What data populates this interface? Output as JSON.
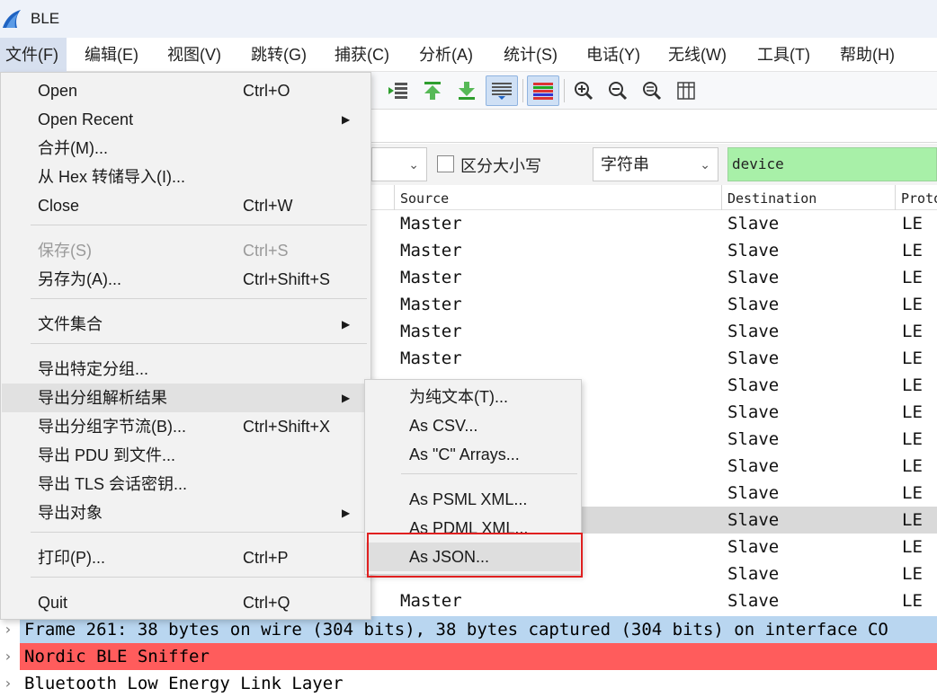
{
  "window": {
    "title": "BLE"
  },
  "menubar": [
    "文件(F)",
    "编辑(E)",
    "视图(V)",
    "跳转(G)",
    "捕获(C)",
    "分析(A)",
    "统计(S)",
    "电话(Y)",
    "无线(W)",
    "工具(T)",
    "帮助(H)"
  ],
  "find": {
    "case_label": "区分大小写",
    "type_value": "字符串",
    "search_value": "device"
  },
  "columns": {
    "source": "Source",
    "destination": "Destination",
    "protocol": "Proto"
  },
  "packets": [
    {
      "source": "Master",
      "destination": "Slave",
      "protocol": "LE"
    },
    {
      "source": "Master",
      "destination": "Slave",
      "protocol": "LE"
    },
    {
      "source": "Master",
      "destination": "Slave",
      "protocol": "LE"
    },
    {
      "source": "Master",
      "destination": "Slave",
      "protocol": "LE"
    },
    {
      "source": "Master",
      "destination": "Slave",
      "protocol": "LE"
    },
    {
      "source": "Master",
      "destination": "Slave",
      "protocol": "LE"
    },
    {
      "source": "",
      "destination": "Slave",
      "protocol": "LE"
    },
    {
      "source": "",
      "destination": "Slave",
      "protocol": "LE"
    },
    {
      "source": "",
      "destination": "Slave",
      "protocol": "LE"
    },
    {
      "source": "",
      "destination": "Slave",
      "protocol": "LE"
    },
    {
      "source": "",
      "destination": "Slave",
      "protocol": "LE"
    },
    {
      "source": "",
      "destination": "Slave",
      "protocol": "LE"
    },
    {
      "source": "",
      "destination": "Slave",
      "protocol": "LE"
    },
    {
      "source": "",
      "destination": "Slave",
      "protocol": "LE"
    },
    {
      "source": "Master",
      "destination": "Slave",
      "protocol": "LE"
    }
  ],
  "details": [
    {
      "text": "Frame 261: 38 bytes on wire (304 bits), 38 bytes captured (304 bits) on interface CO",
      "color": "#b9d6f0"
    },
    {
      "text": "Nordic BLE Sniffer",
      "color": "#ff5c5c"
    },
    {
      "text": "Bluetooth Low Energy Link Layer",
      "color": "#ffffff"
    }
  ],
  "file_menu": {
    "open": "Open",
    "open_sc": "Ctrl+O",
    "open_recent": "Open Recent",
    "merge": "合并(M)...",
    "import_hex": "从 Hex 转储导入(I)...",
    "close": "Close",
    "close_sc": "Ctrl+W",
    "save": "保存(S)",
    "save_sc": "Ctrl+S",
    "save_as": "另存为(A)...",
    "save_as_sc": "Ctrl+Shift+S",
    "file_set": "文件集合",
    "export_specified": "导出特定分组...",
    "export_dissections": "导出分组解析结果",
    "export_bytes": "导出分组字节流(B)...",
    "export_bytes_sc": "Ctrl+Shift+X",
    "export_pdu": "导出 PDU 到文件...",
    "export_tls": "导出 TLS 会话密钥...",
    "export_objects": "导出对象",
    "print": "打印(P)...",
    "print_sc": "Ctrl+P",
    "quit": "Quit",
    "quit_sc": "Ctrl+Q"
  },
  "export_submenu": {
    "plain_text": "为纯文本(T)...",
    "csv": "As CSV...",
    "c_arrays": "As \"C\" Arrays...",
    "psml": "As PSML XML...",
    "pdml": "As PDML XML...",
    "json": "As JSON..."
  }
}
